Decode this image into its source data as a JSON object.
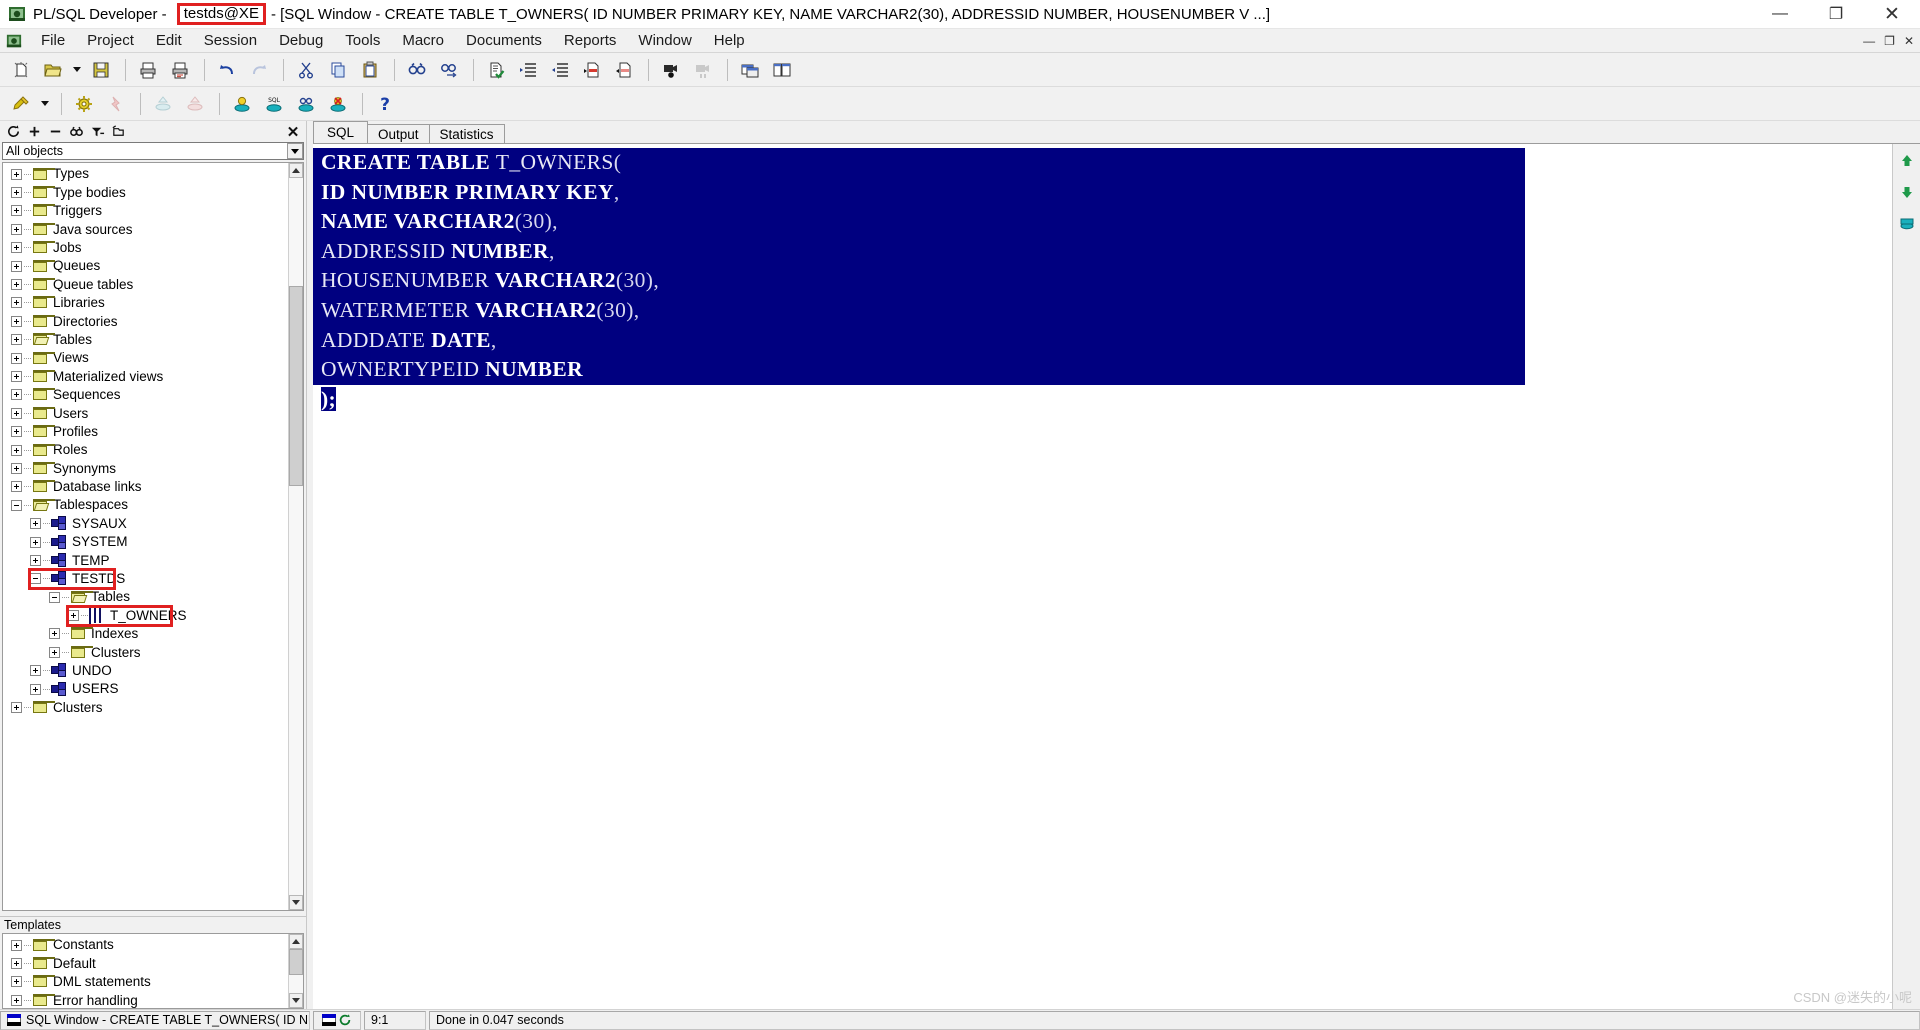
{
  "window": {
    "app_name": "PL/SQL Developer -",
    "connection": "testds@XE",
    "doc_title": "- [SQL Window - CREATE TABLE T_OWNERS( ID NUMBER PRIMARY KEY, NAME VARCHAR2(30), ADDRESSID NUMBER, HOUSENUMBER V ...]",
    "minimize": "—",
    "maximize": "❐",
    "close": "✕",
    "accent_red": "#e02020"
  },
  "menu": {
    "items": [
      {
        "label": "File"
      },
      {
        "label": "Project"
      },
      {
        "label": "Edit"
      },
      {
        "label": "Session"
      },
      {
        "label": "Debug"
      },
      {
        "label": "Tools"
      },
      {
        "label": "Macro"
      },
      {
        "label": "Documents"
      },
      {
        "label": "Reports"
      },
      {
        "label": "Window"
      },
      {
        "label": "Help"
      }
    ],
    "mdi_minimize": "—",
    "mdi_restore": "❐",
    "mdi_close": "✕"
  },
  "toolbar1": {
    "icons": [
      "new-document-icon",
      "open-folder-icon",
      "open-dropdown-caret",
      "save-icon",
      "print-icon",
      "print-preview-icon",
      "undo-icon",
      "redo-icon",
      "cut-icon",
      "copy-icon",
      "paste-icon",
      "find-icon",
      "find-next-icon",
      "check-syntax-icon",
      "indent-icon",
      "outdent-icon",
      "comment-icon",
      "uncomment-icon",
      "record-macro-icon",
      "play-macro-icon",
      "window-list-icon",
      "tile-windows-icon"
    ]
  },
  "toolbar2": {
    "icons": [
      "explain-plan-icon",
      "explain-dropdown-caret",
      "settings-icon",
      "break-icon",
      "commit-disabled-icon",
      "rollback-disabled-icon",
      "execute-icon",
      "execute-sql-icon",
      "find-db-object-icon",
      "kill-session-icon",
      "help-icon"
    ]
  },
  "browser": {
    "toolbar_icons": [
      "refresh-icon",
      "expand-all-icon",
      "collapse-all-icon",
      "find-icon",
      "filter-icon",
      "folder-options-icon"
    ],
    "close_label": "✕",
    "filter_value": "All objects",
    "tree": [
      {
        "label": "Types",
        "depth": 0,
        "icon": "folder-icon",
        "state": "plus"
      },
      {
        "label": "Type bodies",
        "depth": 0,
        "icon": "folder-icon",
        "state": "plus"
      },
      {
        "label": "Triggers",
        "depth": 0,
        "icon": "folder-icon",
        "state": "plus"
      },
      {
        "label": "Java sources",
        "depth": 0,
        "icon": "folder-icon",
        "state": "plus"
      },
      {
        "label": "Jobs",
        "depth": 0,
        "icon": "folder-icon",
        "state": "plus"
      },
      {
        "label": "Queues",
        "depth": 0,
        "icon": "folder-icon",
        "state": "plus"
      },
      {
        "label": "Queue tables",
        "depth": 0,
        "icon": "folder-icon",
        "state": "plus"
      },
      {
        "label": "Libraries",
        "depth": 0,
        "icon": "folder-icon",
        "state": "plus"
      },
      {
        "label": "Directories",
        "depth": 0,
        "icon": "folder-icon",
        "state": "plus"
      },
      {
        "label": "Tables",
        "depth": 0,
        "icon": "folder-open-icon",
        "state": "plus"
      },
      {
        "label": "Views",
        "depth": 0,
        "icon": "folder-icon",
        "state": "plus"
      },
      {
        "label": "Materialized views",
        "depth": 0,
        "icon": "folder-icon",
        "state": "plus"
      },
      {
        "label": "Sequences",
        "depth": 0,
        "icon": "folder-icon",
        "state": "plus"
      },
      {
        "label": "Users",
        "depth": 0,
        "icon": "folder-icon",
        "state": "plus"
      },
      {
        "label": "Profiles",
        "depth": 0,
        "icon": "folder-icon",
        "state": "plus"
      },
      {
        "label": "Roles",
        "depth": 0,
        "icon": "folder-icon",
        "state": "plus"
      },
      {
        "label": "Synonyms",
        "depth": 0,
        "icon": "folder-icon",
        "state": "plus"
      },
      {
        "label": "Database links",
        "depth": 0,
        "icon": "folder-icon",
        "state": "plus"
      },
      {
        "label": "Tablespaces",
        "depth": 0,
        "icon": "folder-open-icon",
        "state": "minus"
      },
      {
        "label": "SYSAUX",
        "depth": 1,
        "icon": "tablespace-icon",
        "state": "plus"
      },
      {
        "label": "SYSTEM",
        "depth": 1,
        "icon": "tablespace-icon",
        "state": "plus"
      },
      {
        "label": "TEMP",
        "depth": 1,
        "icon": "tablespace-icon",
        "state": "plus"
      },
      {
        "label": "TESTDS",
        "depth": 1,
        "icon": "tablespace-icon",
        "state": "minus",
        "highlight": true
      },
      {
        "label": "Tables",
        "depth": 2,
        "icon": "folder-open-icon",
        "state": "minus"
      },
      {
        "label": "T_OWNERS",
        "depth": 3,
        "icon": "table-grid-icon",
        "state": "plus",
        "highlight": true
      },
      {
        "label": "Indexes",
        "depth": 2,
        "icon": "folder-icon",
        "state": "plus"
      },
      {
        "label": "Clusters",
        "depth": 2,
        "icon": "folder-icon",
        "state": "plus"
      },
      {
        "label": "UNDO",
        "depth": 1,
        "icon": "tablespace-icon",
        "state": "plus"
      },
      {
        "label": "USERS",
        "depth": 1,
        "icon": "tablespace-icon",
        "state": "plus"
      },
      {
        "label": "Clusters",
        "depth": 0,
        "icon": "folder-icon",
        "state": "plus"
      }
    ]
  },
  "templates": {
    "title": "Templates",
    "items": [
      {
        "label": "Constants",
        "icon": "folder-icon",
        "state": "plus"
      },
      {
        "label": "Default",
        "icon": "folder-icon",
        "state": "plus"
      },
      {
        "label": "DML statements",
        "icon": "folder-icon",
        "state": "plus"
      },
      {
        "label": "Error handling",
        "icon": "folder-icon",
        "state": "plus"
      }
    ]
  },
  "sql_pane": {
    "tabs": [
      {
        "label": "SQL",
        "active": true
      },
      {
        "label": "Output",
        "active": false
      },
      {
        "label": "Statistics",
        "active": false
      }
    ],
    "selection_color": "#000080",
    "code_lines": [
      [
        {
          "t": "CREATE TABLE ",
          "c": "kw"
        },
        {
          "t": "T_OWNERS",
          "c": "id"
        },
        {
          "t": "(",
          "c": "pn"
        }
      ],
      [
        {
          "t": "ID NUMBER PRIMARY KEY",
          "c": "kw"
        },
        {
          "t": ",",
          "c": "pn"
        }
      ],
      [
        {
          "t": "NAME VARCHAR2",
          "c": "kw"
        },
        {
          "t": "(30),",
          "c": "pn"
        }
      ],
      [
        {
          "t": "ADDRESSID ",
          "c": "id"
        },
        {
          "t": "NUMBER",
          "c": "kw"
        },
        {
          "t": ",",
          "c": "pn"
        }
      ],
      [
        {
          "t": "HOUSENUMBER ",
          "c": "id"
        },
        {
          "t": "VARCHAR2",
          "c": "kw"
        },
        {
          "t": "(30),",
          "c": "pn"
        }
      ],
      [
        {
          "t": "WATERMETER ",
          "c": "id"
        },
        {
          "t": "VARCHAR2",
          "c": "kw"
        },
        {
          "t": "(30),",
          "c": "pn"
        }
      ],
      [
        {
          "t": "ADDDATE ",
          "c": "id"
        },
        {
          "t": "DATE",
          "c": "kw"
        },
        {
          "t": ",",
          "c": "pn"
        }
      ],
      [
        {
          "t": "OWNERTYPEID ",
          "c": "id"
        },
        {
          "t": "NUMBER",
          "c": "kw"
        }
      ],
      [
        {
          "t": ");",
          "c": "kw"
        }
      ]
    ],
    "edge_icons": [
      "scroll-up-icon",
      "scroll-down-icon",
      "query-builder-icon"
    ]
  },
  "status": {
    "window_label": "SQL Window - CREATE TABLE T_OWNERS( ID NUMBEF",
    "session_icon": "session-refresh-icon",
    "cursor_position": "9:1",
    "message": "Done in 0.047 seconds"
  },
  "watermark": {
    "text": "CSDN @迷失的小呢"
  }
}
